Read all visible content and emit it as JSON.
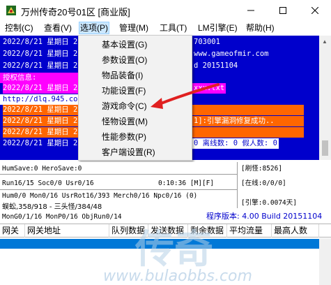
{
  "window": {
    "title": "万州传奇20号01区 [商业版]",
    "icons": {
      "app": "game-app-icon",
      "minimize": "minimize-icon",
      "maximize": "maximize-icon",
      "close": "close-icon"
    }
  },
  "menubar": [
    {
      "label": "控制(C)"
    },
    {
      "label": "查看(V)"
    },
    {
      "label": "选项(P)"
    },
    {
      "label": "管理(M)"
    },
    {
      "label": "工具(T)"
    },
    {
      "label": "LM引擎(E)"
    },
    {
      "label": "帮助(H)"
    }
  ],
  "dropdown": {
    "items": [
      {
        "label": "基本设置(G)"
      },
      {
        "label": "参数设置(O)"
      },
      {
        "label": "物品装备(I)"
      },
      {
        "label": "功能设置(F)"
      },
      {
        "label": "游戏命令(C)"
      },
      {
        "label": "怪物设置(M)"
      },
      {
        "label": "性能参数(P)"
      },
      {
        "label": "客户端设置(R)"
      }
    ]
  },
  "log": {
    "lines": [
      {
        "text": "2022/8/21 星期日 2",
        "right": "703001",
        "style": "blue"
      },
      {
        "text": "2022/8/21 星期日 2",
        "right": "www.gameofmir.com",
        "style": "blue"
      },
      {
        "text": "2022/8/21 星期日 2",
        "right": "d 20151104",
        "style": "blue"
      },
      {
        "text": "授权信息:",
        "right": "",
        "style": "magenta"
      },
      {
        "text": "2022/8/21 星期日 2",
        "right": "xxx.txt",
        "style": "magenta"
      },
      {
        "text": "http://dlq.945.com",
        "right": "",
        "style": "white"
      },
      {
        "text": "2022/8/21 星期日 2",
        "right": "",
        "style": "orange"
      },
      {
        "text": "2022/8/21 星期日 2",
        "right": "1]:引擎漏洞修复成功..",
        "style": "orange"
      },
      {
        "text": "2022/8/21 星期日 2",
        "right": "",
        "style": "orange"
      },
      {
        "text": "2022/8/21 星期日 2",
        "right": "0 离线数: 0 假人数: 0",
        "style": "blue"
      }
    ]
  },
  "status": {
    "line1": "HumSave:0 HeroSave:0",
    "line2": "Run16/15 Soc0/0 Usr0/16",
    "line2_time": "0:10:36 [M][F]",
    "line3": "Hum0/0 Mon0/16 UsrRot16/393 Merch0/16 Npc0/16 (0)",
    "line4": "蜈蚣,358/918 - 三头怪/384/48",
    "line5": "MonG0/1/16 MonP0/16 ObjRun0/14",
    "right_refresh": "[刷怪:8526]",
    "right_online": "[在线:0/0/0]",
    "right_engine": "[引擎:0.0074天]",
    "version": "程序版本: 4.00 Build 20151104"
  },
  "table": {
    "columns": [
      "网关",
      "网关地址",
      "队列数据",
      "发送数据",
      "剩余数据",
      "平均流量",
      "最高人数"
    ]
  },
  "watermark": {
    "text": "www.bulaobbs.com",
    "chars": "传奇"
  },
  "colors": {
    "log_blue": "#0000cc",
    "magenta": "#ff00ff",
    "orange": "#ff6600",
    "menu_active": "#cce8ff",
    "selection": "#0078d7",
    "arrow_red": "#e02020"
  }
}
